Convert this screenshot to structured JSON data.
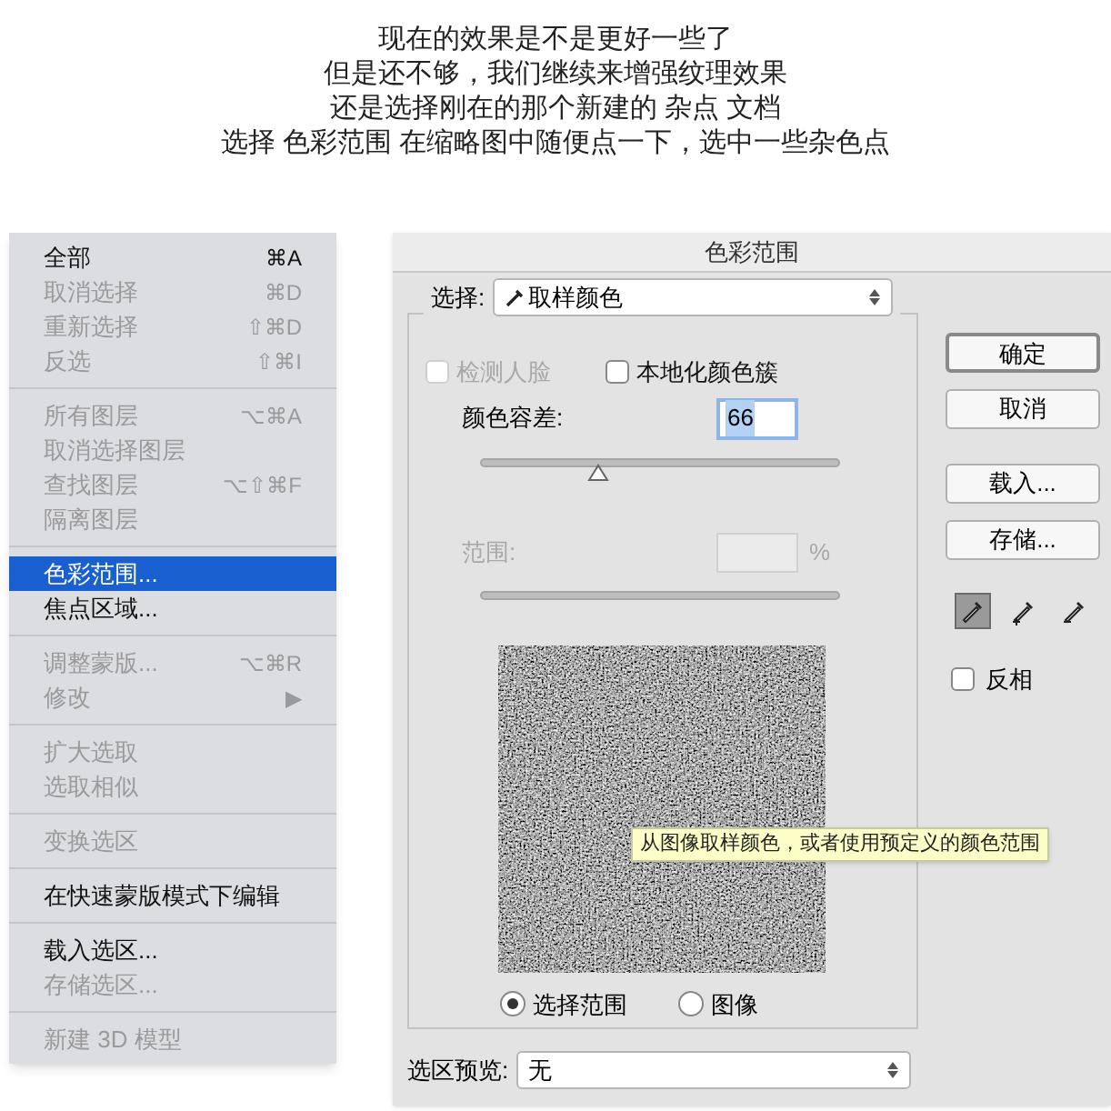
{
  "caption": [
    "现在的效果是不是更好一些了",
    "但是还不够，我们继续来增强纹理效果",
    "还是选择刚在的那个新建的 杂点 文档",
    "选择 色彩范围 在缩略图中随便点一下，选中一些杂色点"
  ],
  "menu": {
    "sections": [
      {
        "items": [
          {
            "label": "全部",
            "shortcut": "⌘A",
            "enabled": true,
            "selected": false
          },
          {
            "label": "取消选择",
            "shortcut": "⌘D",
            "enabled": false,
            "selected": false
          },
          {
            "label": "重新选择",
            "shortcut": "⇧⌘D",
            "enabled": false,
            "selected": false
          },
          {
            "label": "反选",
            "shortcut": "⇧⌘I",
            "enabled": false,
            "selected": false
          }
        ]
      },
      {
        "items": [
          {
            "label": "所有图层",
            "shortcut": "⌥⌘A",
            "enabled": false,
            "selected": false
          },
          {
            "label": "取消选择图层",
            "enabled": false,
            "selected": false
          },
          {
            "label": "查找图层",
            "shortcut": "⌥⇧⌘F",
            "enabled": false,
            "selected": false
          },
          {
            "label": "隔离图层",
            "enabled": false,
            "selected": false
          }
        ]
      },
      {
        "items": [
          {
            "label": "色彩范围...",
            "enabled": true,
            "selected": true
          },
          {
            "label": "焦点区域...",
            "enabled": true,
            "selected": false
          }
        ]
      },
      {
        "items": [
          {
            "label": "调整蒙版...",
            "shortcut": "⌥⌘R",
            "enabled": false,
            "selected": false
          },
          {
            "label": "修改",
            "shortcut": "▶",
            "enabled": false,
            "selected": false
          }
        ]
      },
      {
        "items": [
          {
            "label": "扩大选取",
            "enabled": false,
            "selected": false
          },
          {
            "label": "选取相似",
            "enabled": false,
            "selected": false
          }
        ]
      },
      {
        "items": [
          {
            "label": "变换选区",
            "enabled": false,
            "selected": false
          }
        ]
      },
      {
        "items": [
          {
            "label": "在快速蒙版模式下编辑",
            "enabled": true,
            "selected": false
          }
        ]
      },
      {
        "items": [
          {
            "label": "载入选区...",
            "enabled": true,
            "selected": false
          },
          {
            "label": "存储选区...",
            "enabled": false,
            "selected": false
          }
        ]
      },
      {
        "items": [
          {
            "label": "新建 3D 模型",
            "enabled": false,
            "selected": false
          }
        ]
      }
    ]
  },
  "dialog": {
    "title": "色彩范围",
    "select": {
      "label": "选择:",
      "value": "取样颜色"
    },
    "checkboxes": [
      {
        "label": "检测人脸",
        "checked": false,
        "disabled": true
      },
      {
        "label": "本地化颜色簇",
        "checked": false,
        "disabled": false
      }
    ],
    "tolerance": {
      "label": "颜色容差:",
      "value": "66",
      "level": 0.33
    },
    "range": {
      "label": "范围:",
      "unit": "%",
      "disabled": true
    },
    "tooltip": "从图像取样颜色，或者使用预定义的颜色范围",
    "radios": [
      {
        "label": "选择范围",
        "selected": true
      },
      {
        "label": "图像",
        "selected": false
      }
    ],
    "preview": {
      "label": "选区预览:",
      "value": "无"
    },
    "buttons": [
      {
        "label": "确定",
        "default": true
      },
      {
        "label": "取消",
        "default": false
      },
      {
        "label": "载入...",
        "default": false
      },
      {
        "label": "存储...",
        "default": false
      }
    ],
    "eyedroppers": [
      {
        "kind": "sample",
        "selected": true
      },
      {
        "kind": "add",
        "selected": false
      },
      {
        "kind": "subtract",
        "selected": false
      }
    ],
    "invert": {
      "label": "反相",
      "checked": false
    }
  }
}
